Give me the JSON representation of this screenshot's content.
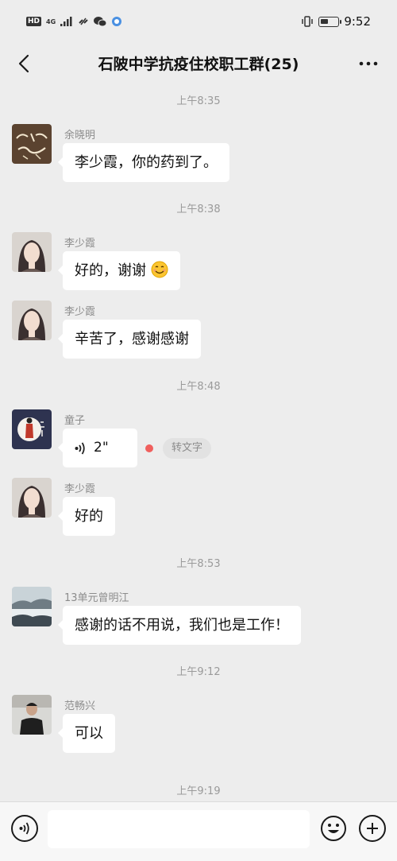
{
  "status_bar": {
    "hd": "HD",
    "network": "4G",
    "time": "9:52",
    "battery_level": 0.45
  },
  "header": {
    "title": "石陂中学抗疫住校职工群(25)"
  },
  "timestamps": [
    "上午8:35",
    "上午8:38",
    "上午8:48",
    "上午8:53",
    "上午9:12",
    "上午9:19"
  ],
  "messages": [
    {
      "sender": "余晓明",
      "text": "李少霞，你的药到了。"
    },
    {
      "sender": "李少霞",
      "text": "好的，谢谢"
    },
    {
      "sender": "李少霞",
      "text": "辛苦了，感谢感谢"
    },
    {
      "sender": "童子",
      "voice_duration": "2\"",
      "transcribe_label": "转文字"
    },
    {
      "sender": "李少霞",
      "text": "好的"
    },
    {
      "sender": "13单元曾明江",
      "text": "感谢的话不用说，我们也是工作！"
    },
    {
      "sender": "范畅兴",
      "text": "可以"
    }
  ],
  "input": {
    "placeholder": ""
  },
  "colors": {
    "background": "#ededed",
    "bubble": "#ffffff",
    "unread_dot": "#f05f5d",
    "timestamp": "#9a9a9a"
  },
  "icons": {
    "back": "chevron-left-icon",
    "more": "more-dots-icon",
    "voice": "voice-icon",
    "emoji": "emoji-icon",
    "plus": "plus-icon"
  }
}
